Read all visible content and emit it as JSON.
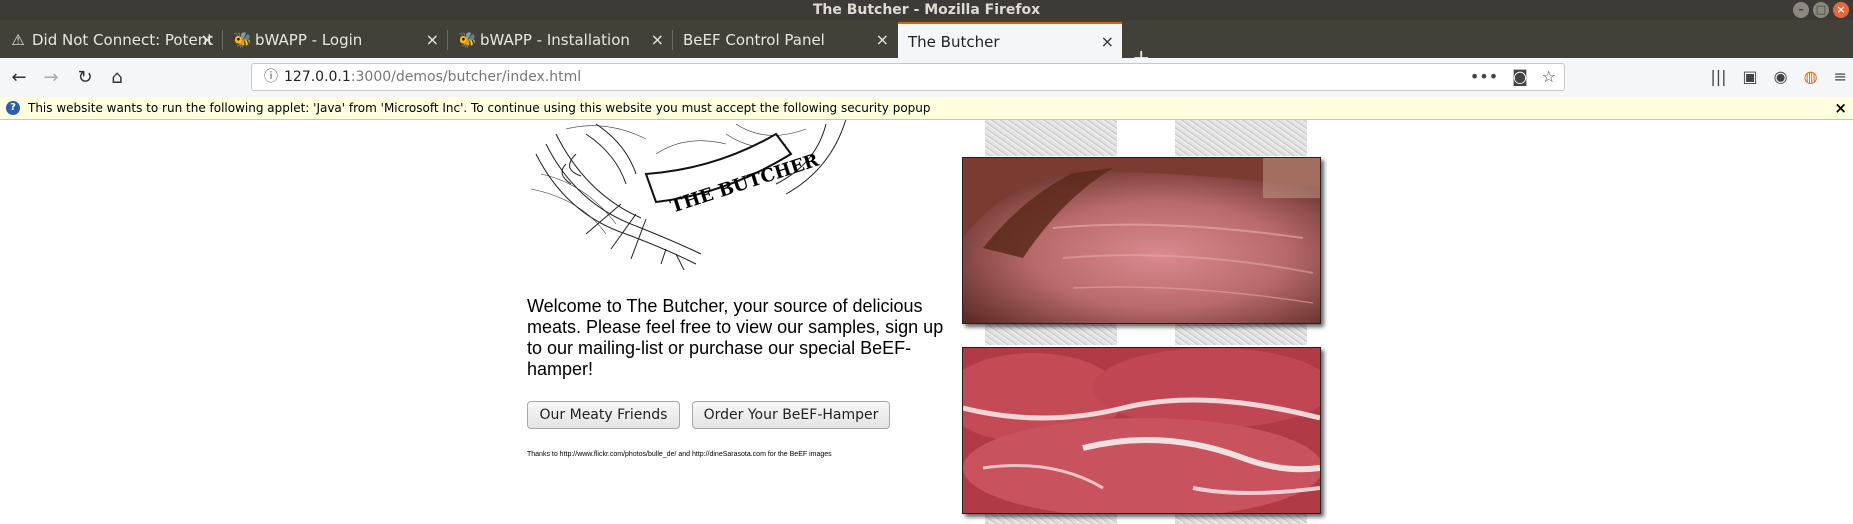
{
  "window": {
    "title": "The Butcher - Mozilla Firefox"
  },
  "tabs": [
    {
      "label": "Did Not Connect: Potent",
      "icon": "warning-icon"
    },
    {
      "label": "bWAPP - Login",
      "icon": "bee-icon"
    },
    {
      "label": "bWAPP - Installation",
      "icon": "bee-icon"
    },
    {
      "label": "BeEF Control Panel",
      "icon": ""
    },
    {
      "label": "The Butcher",
      "icon": "",
      "active": true
    }
  ],
  "url": {
    "host": "127.0.0.1",
    "rest": ":3000/demos/butcher/index.html"
  },
  "notification": {
    "text": "This website wants to run the following applet: 'Java' from 'Microsoft Inc'. To continue using this website you must accept the following security popup"
  },
  "page": {
    "logo_text": "THE BUTCHER",
    "welcome": "Welcome to The Butcher, your source of delicious meats. Please feel free to view our samples, sign up to our mailing-list or purchase our special BeEF-hamper!",
    "buttons": {
      "friends": "Our Meaty Friends",
      "order": "Order Your BeEF-Hamper"
    },
    "thanks": "Thanks to http://www.flickr.com/photos/bulle_de/ and http://dineSarasota.com for the BeEF images"
  },
  "colors": {
    "accent": "#e66000",
    "notification_bg": "#ffffe0",
    "titlebar": "#3c3b37"
  }
}
